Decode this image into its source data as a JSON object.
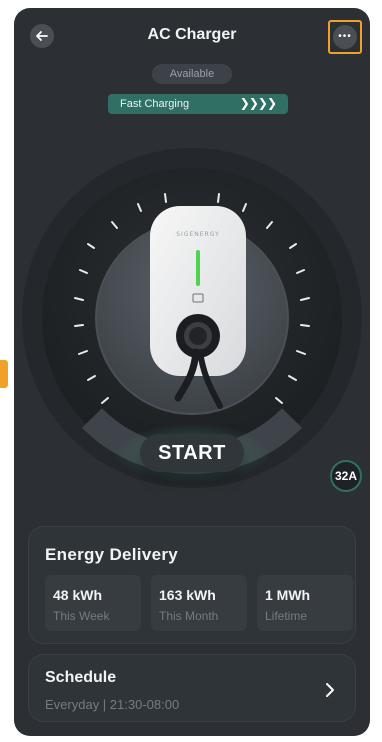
{
  "header": {
    "title": "AC Charger"
  },
  "status": {
    "availability": "Available",
    "mode": "Fast Charging",
    "mode_arrows": "❯❯❯❯"
  },
  "dial": {
    "button_label": "START",
    "current_setting": "32A",
    "brand_text": "SIGENERGY"
  },
  "energy": {
    "title": "Energy Delivery",
    "metrics": [
      {
        "value": "48 kWh",
        "label": "This Week"
      },
      {
        "value": "163 kWh",
        "label": "This Month"
      },
      {
        "value": "1 MWh",
        "label": "Lifetime"
      }
    ]
  },
  "schedule": {
    "title": "Schedule",
    "subtitle": "Everyday  |  21:30-08:00"
  },
  "colors": {
    "bg": "#2c3034",
    "accent": "#2f6f64",
    "highlight": "#f0a12a",
    "indicator": "#4fd24f"
  },
  "icons": {
    "back": "arrow-left-icon",
    "more": "ellipsis-icon",
    "chevron": "chevron-right-icon"
  }
}
